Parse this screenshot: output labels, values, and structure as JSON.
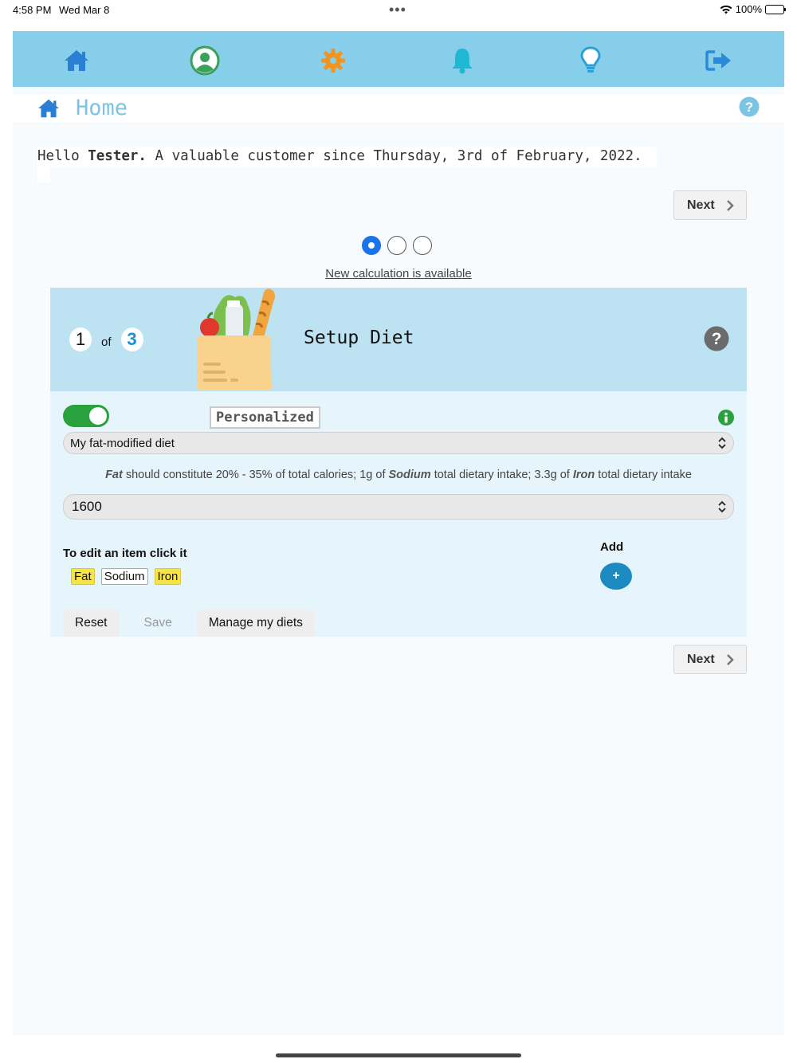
{
  "status_bar": {
    "time": "4:58 PM",
    "date": "Wed Mar 8",
    "battery": "100%"
  },
  "nav": {
    "items": [
      {
        "icon": "home-icon",
        "color": "#2a7fd4"
      },
      {
        "icon": "profile-icon",
        "color": "#3aa15a"
      },
      {
        "icon": "gear-icon",
        "color": "#f3941d"
      },
      {
        "icon": "bell-icon",
        "color": "#1eb8d4"
      },
      {
        "icon": "lightbulb-icon",
        "color": "#2a9fd8"
      },
      {
        "icon": "logout-icon",
        "color": "#2a8ad8"
      }
    ]
  },
  "header": {
    "title": "Home"
  },
  "greeting": {
    "prefix": "Hello ",
    "name": "Tester.",
    "suffix": " A valuable customer since Thursday, 3rd of February, 2022."
  },
  "next_label": "Next",
  "pager": {
    "current": 1,
    "total": 3
  },
  "calculation_link": "New calculation is available",
  "card": {
    "step_current": "1",
    "step_of": "of",
    "step_total": "3",
    "title": "Setup Diet",
    "toggle_on": true,
    "mode_label": "Personalized",
    "diet_select": "My fat-modified diet",
    "description": {
      "n1": "Fat",
      "t1": " should constitute 20% - 35% of total calories; 1g of ",
      "n2": "Sodium",
      "t2": " total dietary intake; 3.3g of ",
      "n3": "Iron",
      "t3": " total dietary intake"
    },
    "calories_select": "1600",
    "edit_label": "To edit an item click it",
    "add_label": "Add",
    "add_button": "+",
    "tags": [
      "Fat",
      "Sodium",
      "Iron"
    ],
    "reset": "Reset",
    "save": "Save",
    "manage": "Manage my diets"
  }
}
